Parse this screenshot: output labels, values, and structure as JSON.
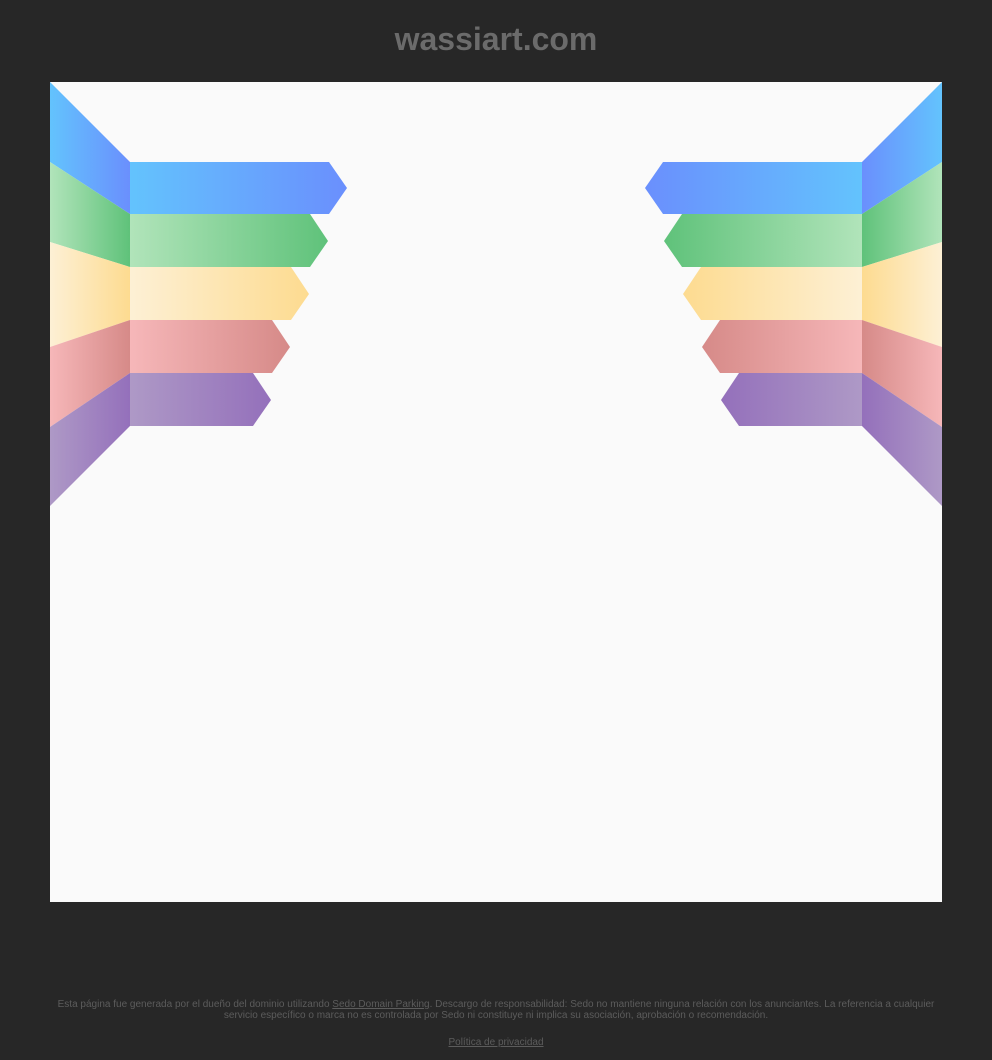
{
  "page": {
    "title": "wassiart.com"
  },
  "footer": {
    "text_before_link": "Esta página fue generada por el dueño del dominio utilizando ",
    "link_label": "Sedo Domain Parking",
    "text_after_link": ". Descargo de responsabilidad: Sedo no mantiene ninguna relación con los anunciantes. La referencia a cualquier servicio específico o marca no es controlada por Sedo ni constituye ni implica su asociación, aprobación o recomendación.",
    "privacy_label": "Política de privacidad"
  },
  "colors": {
    "background": "#272727",
    "panel": "#fafafa",
    "title": "#6b6b6b",
    "footer_text": "#5c5c5c",
    "ribbon_blue": [
      "#63c3fd",
      "#6a8ffd"
    ],
    "ribbon_green": [
      "#b1e4ba",
      "#5fc27a"
    ],
    "ribbon_yellow": [
      "#fdf0d5",
      "#fddb90"
    ],
    "ribbon_red": [
      "#f6b7b9",
      "#d68a88"
    ],
    "ribbon_purple": [
      "#ae99c6",
      "#9470bb"
    ]
  },
  "artwork": {
    "name": "wing-ribbons",
    "bands": [
      "blue",
      "green",
      "yellow",
      "red",
      "purple"
    ]
  }
}
